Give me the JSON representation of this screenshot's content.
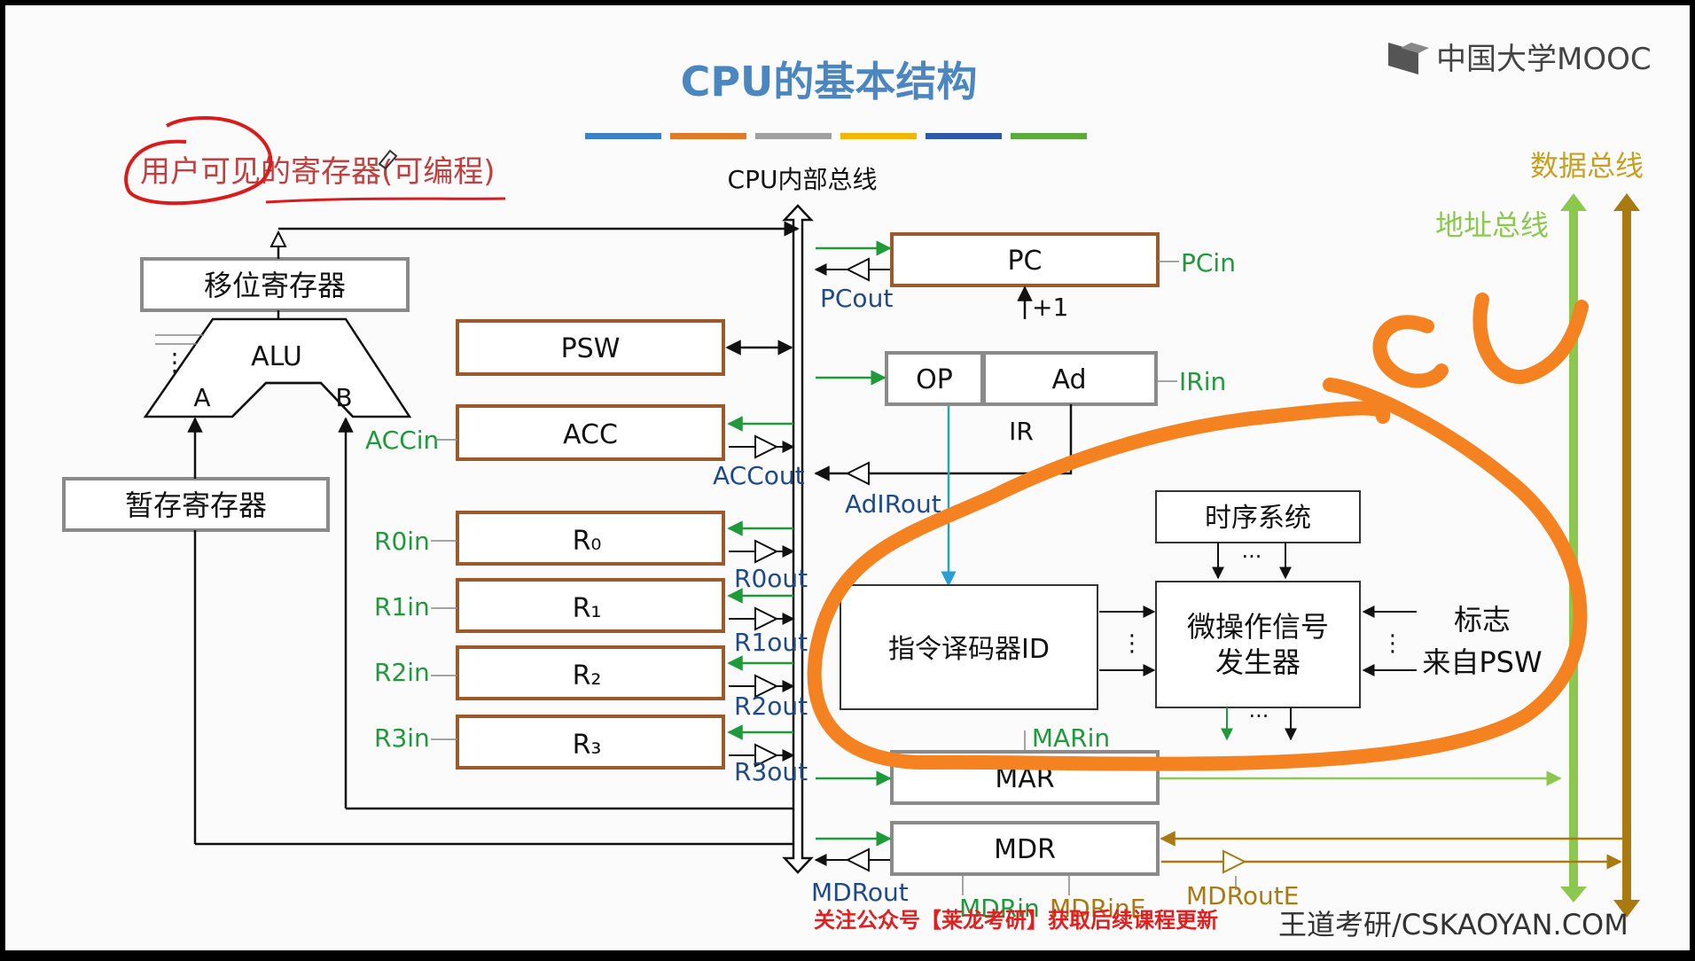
{
  "slide": {
    "title": "CPU的基本结构",
    "logo_text": "中国大学MOOC",
    "title_bar_colors": [
      "#3b82c4",
      "#e07b2a",
      "#a0a0a0",
      "#f2b705",
      "#2f5aa8",
      "#5aaa3c"
    ]
  },
  "annotation": {
    "label": "用户可见的寄存器(可编程)",
    "cu_text": "CU"
  },
  "bus": {
    "internal": "CPU内部总线",
    "data": "数据总线",
    "address": "地址总线"
  },
  "blocks": {
    "shift_register": "移位寄存器",
    "alu": "ALU",
    "alu_a": "A",
    "alu_b": "B",
    "temp_register": "暂存寄存器",
    "psw": "PSW",
    "acc": "ACC",
    "r0": "R₀",
    "r1": "R₁",
    "r2": "R₂",
    "r3": "R₃",
    "pc": "PC",
    "pc_inc": "+1",
    "op": "OP",
    "ad": "Ad",
    "ir": "IR",
    "timing": "时序系统",
    "decoder": "指令译码器ID",
    "micro_gen_line1": "微操作信号",
    "micro_gen_line2": "发生器",
    "flags_line1": "标志",
    "flags_line2": "来自PSW",
    "mar": "MAR",
    "mdr": "MDR",
    "dots": "⋮",
    "hdots": "···"
  },
  "signals": {
    "pc_in": "PCin",
    "pc_out": "PCout",
    "ir_in": "IRin",
    "ad_ir_out": "AdIRout",
    "acc_in": "ACCin",
    "acc_out": "ACCout",
    "r0_in": "R0in",
    "r1_in": "R1in",
    "r2_in": "R2in",
    "r3_in": "R3in",
    "r0_out": "R0out",
    "r1_out": "R1out",
    "r2_out": "R2out",
    "r3_out": "R3out",
    "mar_in": "MARin",
    "mdr_out": "MDRout",
    "mdr_in": "MDRin",
    "mdr_in_e": "MDRinE",
    "mdr_out_e": "MDRoutE"
  },
  "footer": {
    "promo": "关注公众号【莱龙考研】获取后续课程更新",
    "brand": "王道考研/CSKAOYAN.COM"
  },
  "colors": {
    "register_border": "#9a5a2a",
    "gray_border": "#8a8a8a",
    "signal_green": "#1f9a3a",
    "address_bus": "#8cc850",
    "data_bus": "#a87a10",
    "title": "#4a86c0",
    "highlight_orange": "#f58220",
    "annotation_red": "#d81c1c"
  }
}
